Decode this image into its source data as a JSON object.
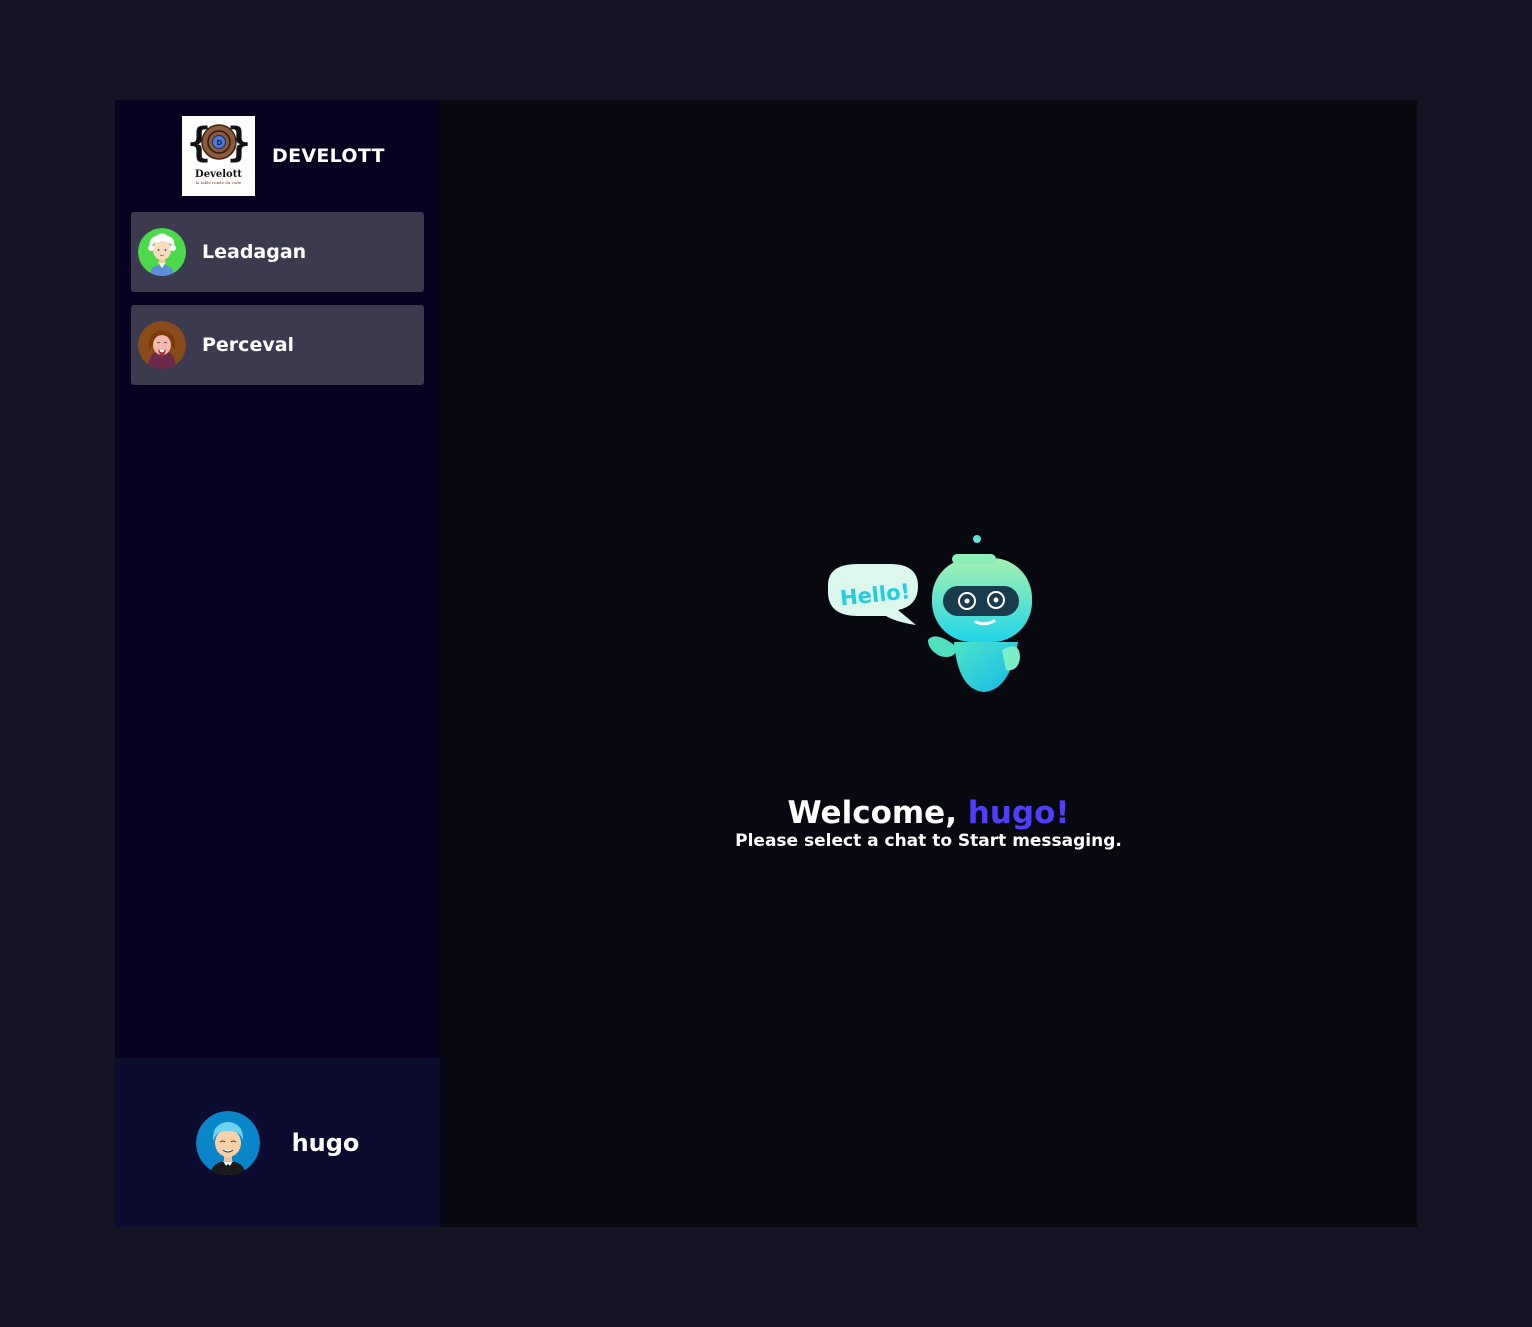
{
  "brand": {
    "logo_text": "Develott",
    "logo_tagline": "la table ronde du code",
    "logo_icon": "develott-logo-icon",
    "title": "DEVELOTT"
  },
  "contacts": [
    {
      "name": "Leadagan",
      "avatar": "avatar-white-haired-man-icon",
      "avatar_bg": "#4cd94c"
    },
    {
      "name": "Perceval",
      "avatar": "avatar-long-haired-man-icon",
      "avatar_bg": "#8a4b1a"
    }
  ],
  "current_user": {
    "name": "hugo",
    "avatar": "avatar-blue-haired-man-icon",
    "avatar_bg": "#0b85c9"
  },
  "welcome": {
    "illustration": "hello-robot-icon",
    "speech_bubble": "Hello!",
    "greeting": "Welcome, ",
    "username": "hugo!",
    "subtitle": "Please select a chat to Start messaging."
  },
  "colors": {
    "page_bg": "#131324",
    "sidebar_bg": "#060220",
    "contact_bg": "#3c3a4f",
    "current_user_bg": "#0b0c2e",
    "main_bg": "#080810",
    "accent": "#4e3fff"
  }
}
